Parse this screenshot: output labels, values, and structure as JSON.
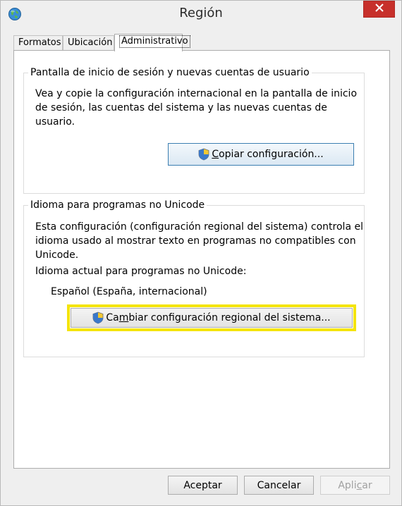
{
  "window": {
    "title": "Región",
    "close_glyph": "✕",
    "close_color": "#c7302b"
  },
  "tabs": [
    {
      "label": "Formatos"
    },
    {
      "label": "Ubicación"
    },
    {
      "label": "Administrativo"
    }
  ],
  "welcome_group": {
    "legend": "Pantalla de inicio de sesión y nuevas cuentas de usuario",
    "description_line1": "Vea y copie la configuración internacional en la pantalla de inicio",
    "description_line2": "de sesión, las cuentas del sistema y las nuevas cuentas de usuario.",
    "copy_button": {
      "prefix": "",
      "accel": "C",
      "suffix": "opiar configuración...",
      "icon": "uac-shield-icon"
    }
  },
  "unicode_group": {
    "legend": "Idioma para programas no Unicode",
    "description_line1": "Esta configuración (configuración regional del sistema) controla el",
    "description_line2": "idioma usado al mostrar texto en programas no compatibles con",
    "description_line3": "Unicode.",
    "current_label": "Idioma actual para programas no Unicode:",
    "current_value": "Español (España, internacional)",
    "change_button": {
      "prefix": "Ca",
      "accel": "m",
      "suffix": "biar configuración regional del sistema...",
      "icon": "uac-shield-icon"
    },
    "highlight_color": "#f4e40c"
  },
  "footer": {
    "ok": "Aceptar",
    "cancel": "Cancelar",
    "apply_prefix": "Apli",
    "apply_accel": "c",
    "apply_suffix": "ar"
  }
}
